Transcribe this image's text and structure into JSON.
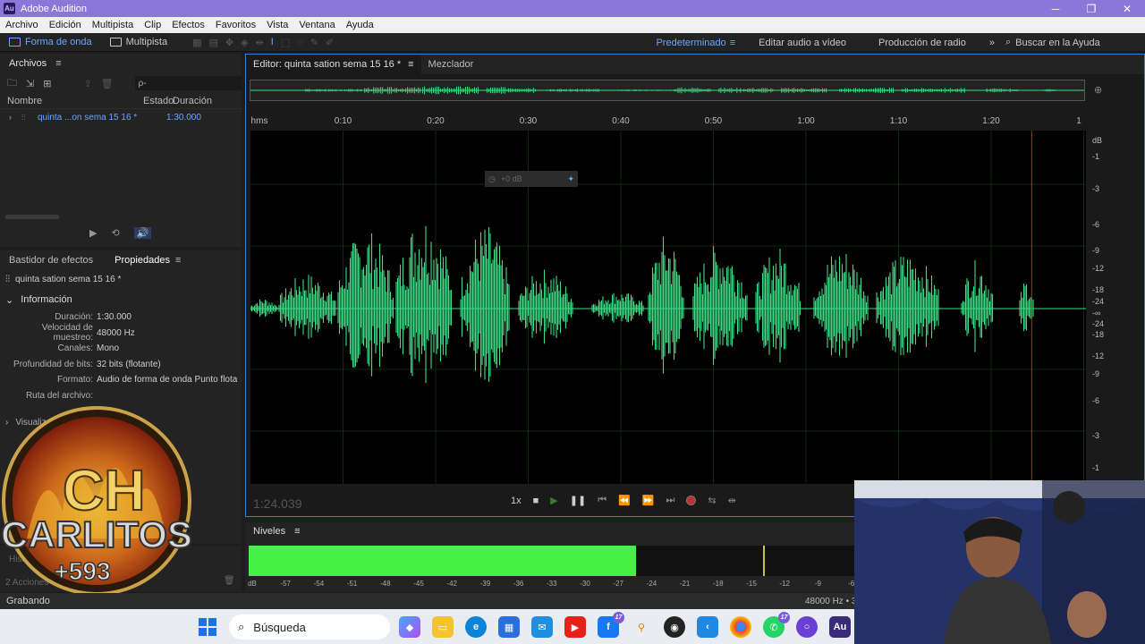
{
  "window": {
    "title": "Adobe Audition",
    "app_icon_text": "Au"
  },
  "menu": [
    "Archivo",
    "Edición",
    "Multipista",
    "Clip",
    "Efectos",
    "Favoritos",
    "Vista",
    "Ventana",
    "Ayuda"
  ],
  "toolbar": {
    "waveform_label": "Forma de onda",
    "multitrack_label": "Multipista",
    "workspaces": [
      "Predeterminado",
      "Editar audio a vídeo",
      "Producción de radio"
    ],
    "search_placeholder": "Buscar en la Ayuda"
  },
  "files_panel": {
    "title": "Archivos",
    "search_placeholder": "ρ-",
    "columns": [
      "Nombre",
      "Estado",
      "Duración"
    ],
    "rows": [
      {
        "name": "quinta ...on sema 15 16  *",
        "duration": "1:30.000"
      }
    ]
  },
  "props_panel": {
    "tabs": [
      "Bastidor de efectos",
      "Propiedades"
    ],
    "file_title": "quinta sation sema 15 16  *",
    "section": "Información",
    "rows": [
      {
        "label": "Duración:",
        "value": "1:30.000"
      },
      {
        "label": "Velocidad de muestreo:",
        "value": "48000 Hz"
      },
      {
        "label": "Canales:",
        "value": "Mono"
      },
      {
        "label": "Profundidad de bits:",
        "value": "32 bits (flotante)"
      },
      {
        "label": "Formato:",
        "value": "Audio de forma de onda Punto flotante"
      },
      {
        "label": "Ruta del archivo:",
        "value": ""
      }
    ],
    "collapsed_section": "Visualización de la lista"
  },
  "history": {
    "label": "Historial",
    "actions": "2 Acciones"
  },
  "logo": {
    "text_top": "CH",
    "text_name": "CARLITOS",
    "text_code": "+593"
  },
  "editor": {
    "tab_label": "Editor: quinta sation sema 15 16  *",
    "mixer_label": "Mezclador",
    "ruler_unit": "hms",
    "ruler_ticks": [
      "0:10",
      "0:20",
      "0:30",
      "0:40",
      "0:50",
      "1:00",
      "1:10",
      "1:20",
      "1"
    ],
    "hud_text": "+0 dB",
    "db_label": "dB",
    "db_ticks": [
      "-1",
      "-3",
      "-6",
      "-9",
      "-12",
      "-18",
      "-24",
      "-∞",
      "-24",
      "-18",
      "-12",
      "-9",
      "-6",
      "-3",
      "-1"
    ],
    "time_display": "1:24.039",
    "speed": "1x",
    "playhead_fraction": 0.935
  },
  "levels": {
    "title": "Niveles",
    "scale": [
      "dB",
      "-57",
      "-54",
      "-51",
      "-48",
      "-45",
      "-42",
      "-39",
      "-36",
      "-33",
      "-30",
      "-27",
      "-24",
      "-21",
      "-18",
      "-15",
      "-12",
      "-9",
      "-6"
    ],
    "level_fraction": 0.637,
    "peak_fraction": 0.845
  },
  "status": {
    "left": "Grabando",
    "right": "48000 Hz • 32"
  },
  "taskbar": {
    "search_label": "Búsqueda"
  },
  "colors": {
    "accent": "#6aa7ff",
    "waveform": "#3ddc84",
    "level": "#44f144",
    "titlebar": "#8a78d8"
  }
}
